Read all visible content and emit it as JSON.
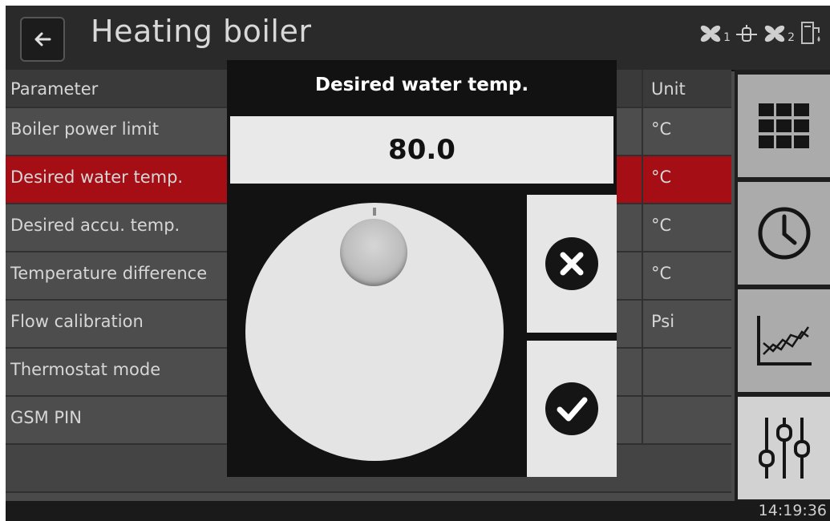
{
  "header": {
    "title": "Heating boiler"
  },
  "status": {
    "fan1_sub": "1",
    "fan2_sub": "2"
  },
  "table": {
    "headers": {
      "parameter": "Parameter",
      "unit": "Unit"
    },
    "rows": [
      {
        "parameter": "Boiler power limit",
        "unit": "°C"
      },
      {
        "parameter": "Desired water temp.",
        "unit": "°C"
      },
      {
        "parameter": "Desired accu. temp.",
        "unit": "°C"
      },
      {
        "parameter": "Temperature difference",
        "unit": "°C"
      },
      {
        "parameter": "Flow calibration",
        "unit": "Psi"
      },
      {
        "parameter": "Thermostat mode",
        "unit": ""
      },
      {
        "parameter": "GSM PIN",
        "unit": ""
      }
    ],
    "selected_row": "Desired water temp."
  },
  "nav": [
    "grid-menu-icon",
    "clock-icon",
    "chart-icon",
    "sliders-icon"
  ],
  "modal": {
    "title": "Desired water temp.",
    "value": "80.0"
  },
  "footer": {
    "time": "14:19:36"
  },
  "colors": {
    "selected_row": "#a50e14",
    "background": "#4a4a4a",
    "modal": "#121212"
  }
}
